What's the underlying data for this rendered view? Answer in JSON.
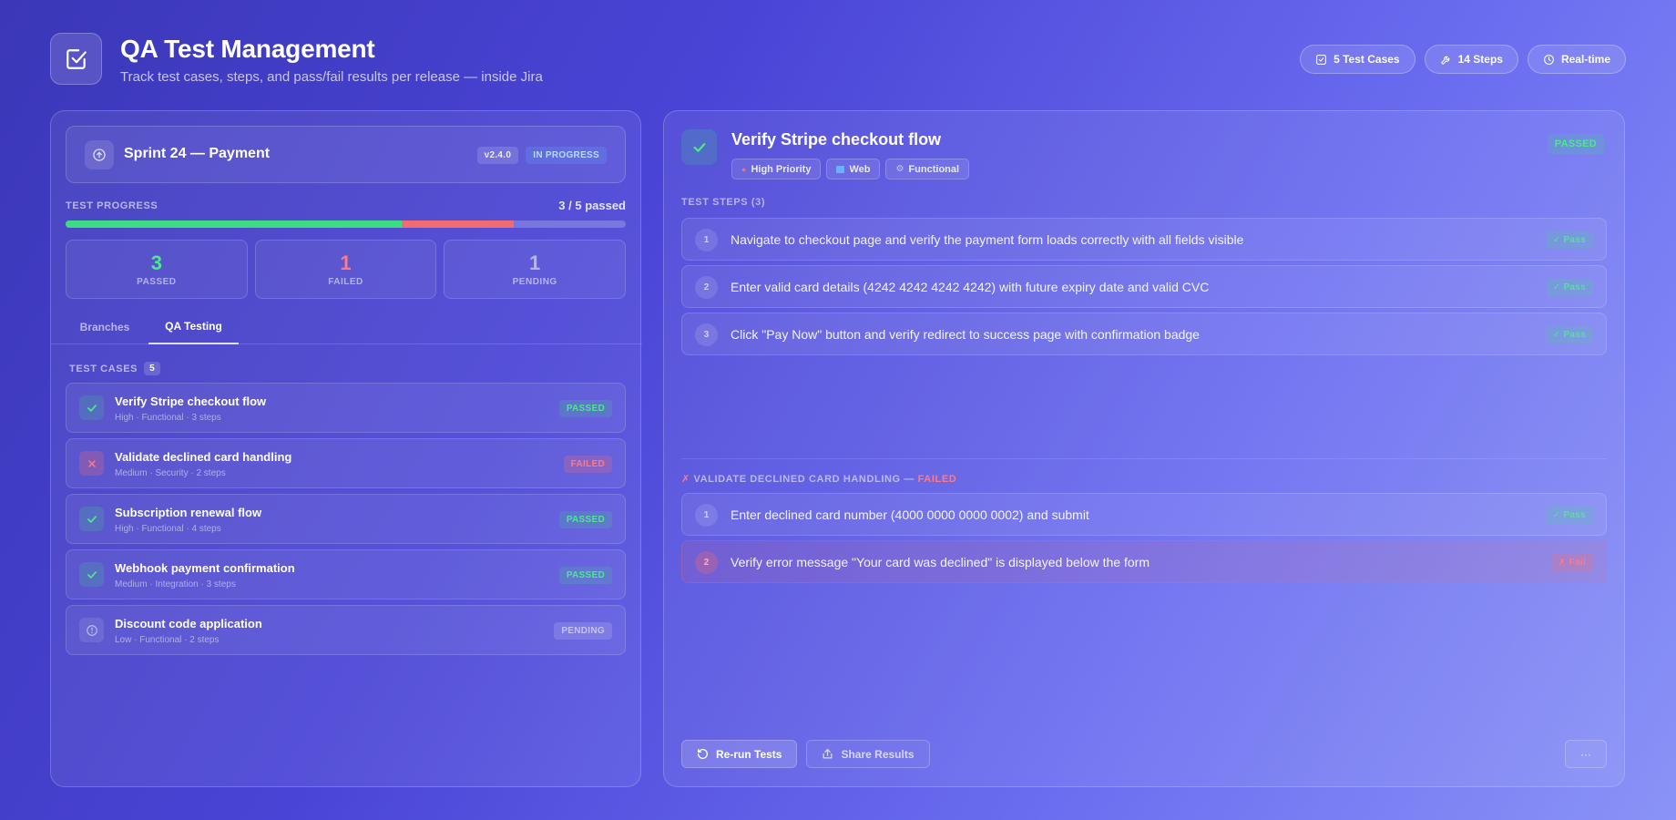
{
  "header": {
    "title": "QA Test Management",
    "subtitle": "Track test cases, steps, and pass/fail results per release — inside Jira",
    "chips": [
      {
        "label": "5 Test Cases",
        "icon": "checkbox-icon"
      },
      {
        "label": "14 Steps",
        "icon": "wrench-icon"
      },
      {
        "label": "Real-time",
        "icon": "clock-icon"
      }
    ]
  },
  "sprint": {
    "title": "Sprint 24 — Payment",
    "version": "v2.4.0",
    "status": "IN PROGRESS"
  },
  "progress": {
    "label": "TEST PROGRESS",
    "summary": "3 / 5 passed",
    "passed_fraction": 0.6,
    "failed_fraction": 0.2
  },
  "stats": {
    "passed": {
      "value": "3",
      "label": "PASSED"
    },
    "failed": {
      "value": "1",
      "label": "FAILED"
    },
    "pending": {
      "value": "1",
      "label": "PENDING"
    }
  },
  "tabs": {
    "branches": "Branches",
    "qa": "QA Testing"
  },
  "test_cases": {
    "title": "TEST CASES",
    "count": "5",
    "items": [
      {
        "title": "Verify Stripe checkout flow",
        "meta": "High · Functional · 3 steps",
        "status": "PASSED"
      },
      {
        "title": "Validate declined card handling",
        "meta": "Medium · Security · 2 steps",
        "status": "FAILED"
      },
      {
        "title": "Subscription renewal flow",
        "meta": "High · Functional · 4 steps",
        "status": "PASSED"
      },
      {
        "title": "Webhook payment confirmation",
        "meta": "Medium · Integration · 3 steps",
        "status": "PASSED"
      },
      {
        "title": "Discount code application",
        "meta": "Low · Functional · 2 steps",
        "status": "PENDING"
      }
    ]
  },
  "detail": {
    "title": "Verify Stripe checkout flow",
    "status": "PASSED",
    "tags": [
      "High Priority",
      "Web",
      "Functional"
    ],
    "steps_title": "TEST STEPS (3)",
    "steps": [
      {
        "num": "1",
        "text": "Navigate to checkout page and verify the payment form loads correctly with all fields visible",
        "result": "✓ Pass"
      },
      {
        "num": "2",
        "text": "Enter valid card details (4242 4242 4242 4242) with future expiry date and valid CVC",
        "result": "✓ Pass"
      },
      {
        "num": "3",
        "text": "Click \"Pay Now\" button and verify redirect to success page with confirmation badge",
        "result": "✓ Pass"
      }
    ],
    "fail_section": {
      "prefix": "✗",
      "title": "VALIDATE DECLINED CARD HANDLING —",
      "status": "FAILED",
      "steps": [
        {
          "num": "1",
          "text": "Enter declined card number (4000 0000 0000 0002) and submit",
          "result": "✓ Pass"
        },
        {
          "num": "2",
          "text": "Verify error message \"Your card was declined\" is displayed below the form",
          "result": "✗ Fail"
        }
      ]
    }
  },
  "actions": {
    "rerun": "Re-run Tests",
    "share": "Share Results",
    "more": "···"
  }
}
